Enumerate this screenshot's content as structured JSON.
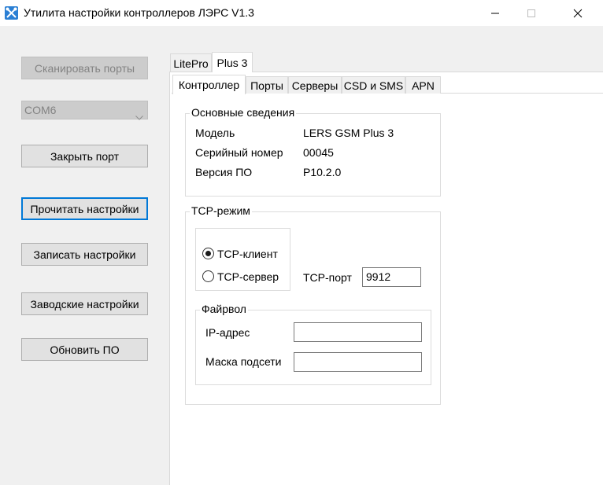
{
  "window": {
    "title": "Утилита настройки контроллеров ЛЭРС V1.3"
  },
  "left": {
    "scan_ports": "Сканировать порты",
    "port_select": {
      "value": "COM6"
    },
    "close_port": "Закрыть порт",
    "read_settings": "Прочитать настройки",
    "write_settings": "Записать настройки",
    "factory_settings": "Заводские настройки",
    "update_firmware": "Обновить ПО"
  },
  "outer_tabs": [
    "LitePro",
    "Plus 3"
  ],
  "outer_tab_active": "Plus 3",
  "inner_tabs": [
    "Контроллер",
    "Порты",
    "Серверы",
    "CSD и SMS",
    "APN"
  ],
  "inner_tab_active": "Контроллер",
  "info": {
    "legend": "Основные сведения",
    "model_label": "Модель",
    "model_value": "LERS GSM Plus 3",
    "serial_label": "Серийный номер",
    "serial_value": "00045",
    "firmware_label": "Версия ПО",
    "firmware_value": "P10.2.0"
  },
  "tcp": {
    "legend": "TCP-режим",
    "client_label": "TCP-клиент",
    "server_label": "TCP-сервер",
    "selected": "client",
    "port_label": "TCP-порт",
    "port_value": "9912"
  },
  "firewall": {
    "legend": "Файрвол",
    "ip_label": "IP-адрес",
    "ip_value": "",
    "mask_label": "Маска подсети",
    "mask_value": ""
  },
  "colors": {
    "accent": "#0078d7",
    "window_bg": "#f0f0f0",
    "panel_bg": "#ffffff"
  }
}
